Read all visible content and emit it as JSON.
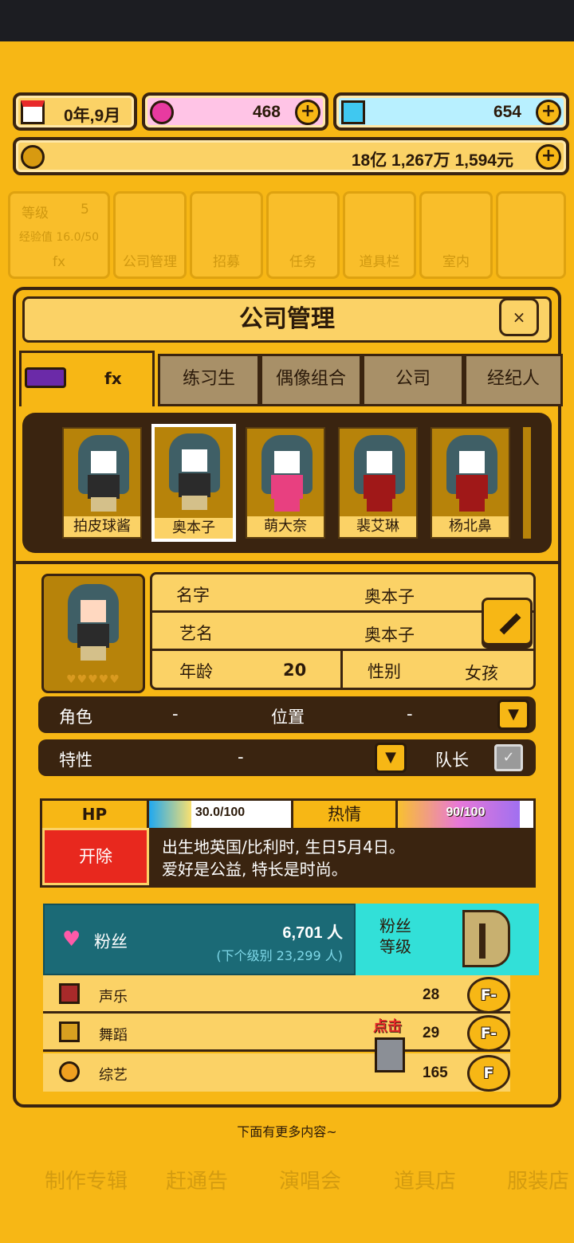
{
  "resources": {
    "date": "0年,9月",
    "gems_pink": "468",
    "gems_blue": "654",
    "money": "18亿 1,267万 1,594元"
  },
  "background_menu": {
    "level_label": "等级",
    "level_value": "5",
    "exp_label": "经验值 16.0/50",
    "company_short": "fx",
    "items": [
      "公司管理",
      "招募",
      "任务",
      "道具栏",
      "室内"
    ]
  },
  "background_bottom": [
    "制作专辑",
    "赶通告",
    "演唱会",
    "道具店",
    "服装店"
  ],
  "panel": {
    "title": "公司管理",
    "close": "×"
  },
  "tabs": [
    {
      "label": "fx"
    },
    {
      "label": "练习生"
    },
    {
      "label": "偶像组合"
    },
    {
      "label": "公司"
    },
    {
      "label": "经纪人"
    }
  ],
  "members": [
    "拍皮球酱",
    "奥本子",
    "萌大奈",
    "裴艾琳",
    "杨北鼻"
  ],
  "profile": {
    "name_label": "名字",
    "name": "奥本子",
    "stage_label": "艺名",
    "stage_name": "奥本子",
    "age_label": "年龄",
    "age": "20",
    "gender_label": "性别",
    "gender": "女孩"
  },
  "role_row": {
    "role_label": "角色",
    "role_value": "-",
    "pos_label": "位置",
    "pos_value": "-"
  },
  "trait_row": {
    "trait_label": "特性",
    "trait_value": "-",
    "leader_label": "队长"
  },
  "stats": {
    "hp_label": "HP",
    "hp_text": "30.0/100",
    "hp_fraction": 0.3,
    "passion_label": "热情",
    "passion_text": "90/100",
    "passion_fraction": 0.9,
    "fire_label": "开除",
    "bio_line1": "出生地英国/比利时, 生日5月4日。",
    "bio_line2": "爱好是公益, 特长是时尚。"
  },
  "fans": {
    "label": "粉丝",
    "count": "6,701 人",
    "next": "(下个级别 23,299 人)",
    "grade_label_1": "粉丝",
    "grade_label_2": "等级"
  },
  "skills": [
    {
      "name": "声乐",
      "value": "28",
      "rank": "F-"
    },
    {
      "name": "舞蹈",
      "value": "29",
      "rank": "F-"
    },
    {
      "name": "综艺",
      "value": "165",
      "rank": "F"
    }
  ],
  "tap_hint": "点击",
  "more_hint": "下面有更多内容~"
}
